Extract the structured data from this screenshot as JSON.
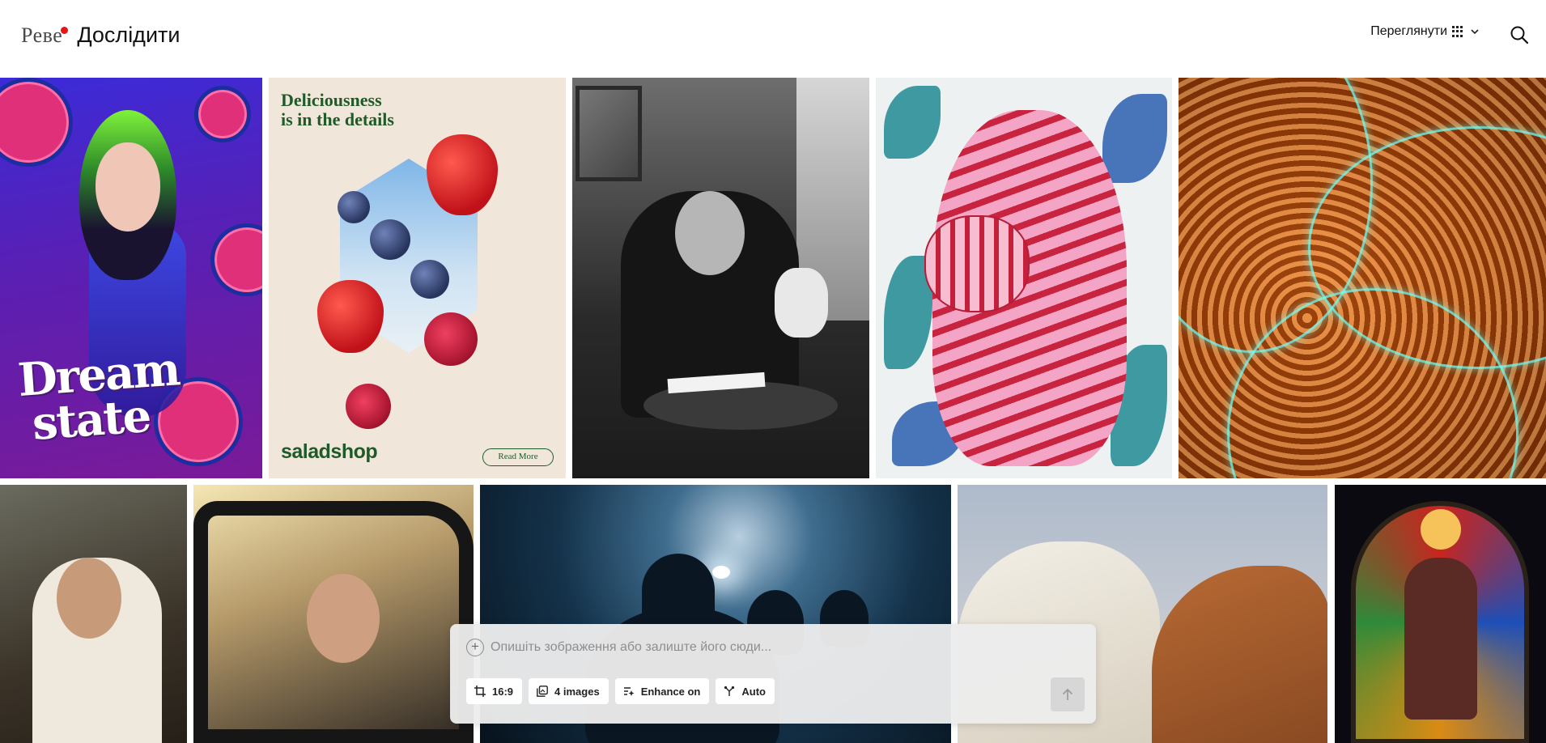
{
  "header": {
    "logo_text": "Реве",
    "title": "Дослідити",
    "view_menu_label": "Переглянути"
  },
  "gallery": {
    "row1": [
      {
        "name": "dream-state-poster",
        "text_lines": [
          "Dream",
          "state"
        ]
      },
      {
        "name": "saladshop-ad",
        "headline_lines": [
          "Deliciousness",
          "is in the details"
        ],
        "brand": "saladshop",
        "button": "Read More"
      },
      {
        "name": "man-with-dog-photo"
      },
      {
        "name": "pink-tiger-painting"
      },
      {
        "name": "coral-macro-photo"
      }
    ],
    "row2": [
      {
        "name": "old-man-cafe-photo"
      },
      {
        "name": "man-in-car-photo"
      },
      {
        "name": "silhouettes-photo"
      },
      {
        "name": "horses-photo"
      },
      {
        "name": "stained-glass-photo"
      }
    ]
  },
  "composer": {
    "placeholder": "Опишіть зображення або залиште його сюди...",
    "options": [
      {
        "icon": "crop-icon",
        "label": "16:9"
      },
      {
        "icon": "images-icon",
        "label": "4 images"
      },
      {
        "icon": "enhance-icon",
        "label": "Enhance on"
      },
      {
        "icon": "auto-icon",
        "label": "Auto"
      }
    ],
    "send_icon": "arrow-up-icon"
  },
  "colors": {
    "logo_dot": "#e8141a",
    "ad_green": "#1f5b28",
    "composer_bg": "#ececec"
  }
}
